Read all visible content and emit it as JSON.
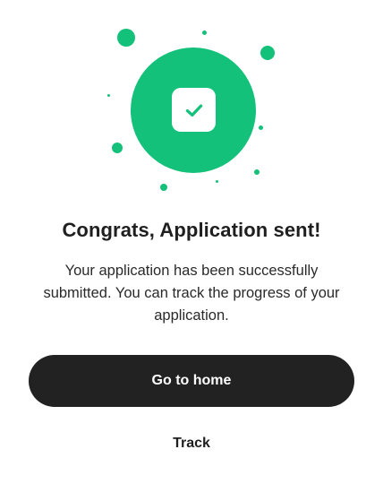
{
  "theme": {
    "accent": "#14c17a",
    "button_dark": "#222222",
    "check_color": "#14c17a"
  },
  "illustration": {
    "center_icon": "check-icon"
  },
  "content": {
    "title": "Congrats, Application sent!",
    "description": "Your application has been successfully submitted. You can track the progress of your application."
  },
  "actions": {
    "primary_label": "Go to home",
    "secondary_label": "Track"
  }
}
